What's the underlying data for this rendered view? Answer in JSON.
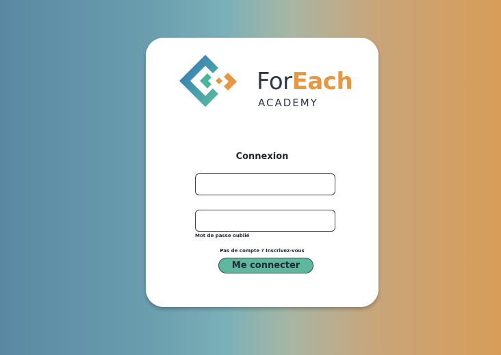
{
  "brand": {
    "name_part1": "For",
    "name_part2": "Each",
    "subtitle": "ACADEMY"
  },
  "login": {
    "title": "Connexion",
    "username_value": "",
    "password_value": "",
    "forgot_password_label": "Mot de passe oublié",
    "signup_prompt": "Pas de compte ? Inscrivez-vous",
    "submit_label": "Me connecter"
  },
  "colors": {
    "accent_orange": "#e8963f",
    "accent_teal": "#5fb89e",
    "text_dark": "#1f2636"
  },
  "icons": {
    "logo": "foreach-logo-icon"
  }
}
